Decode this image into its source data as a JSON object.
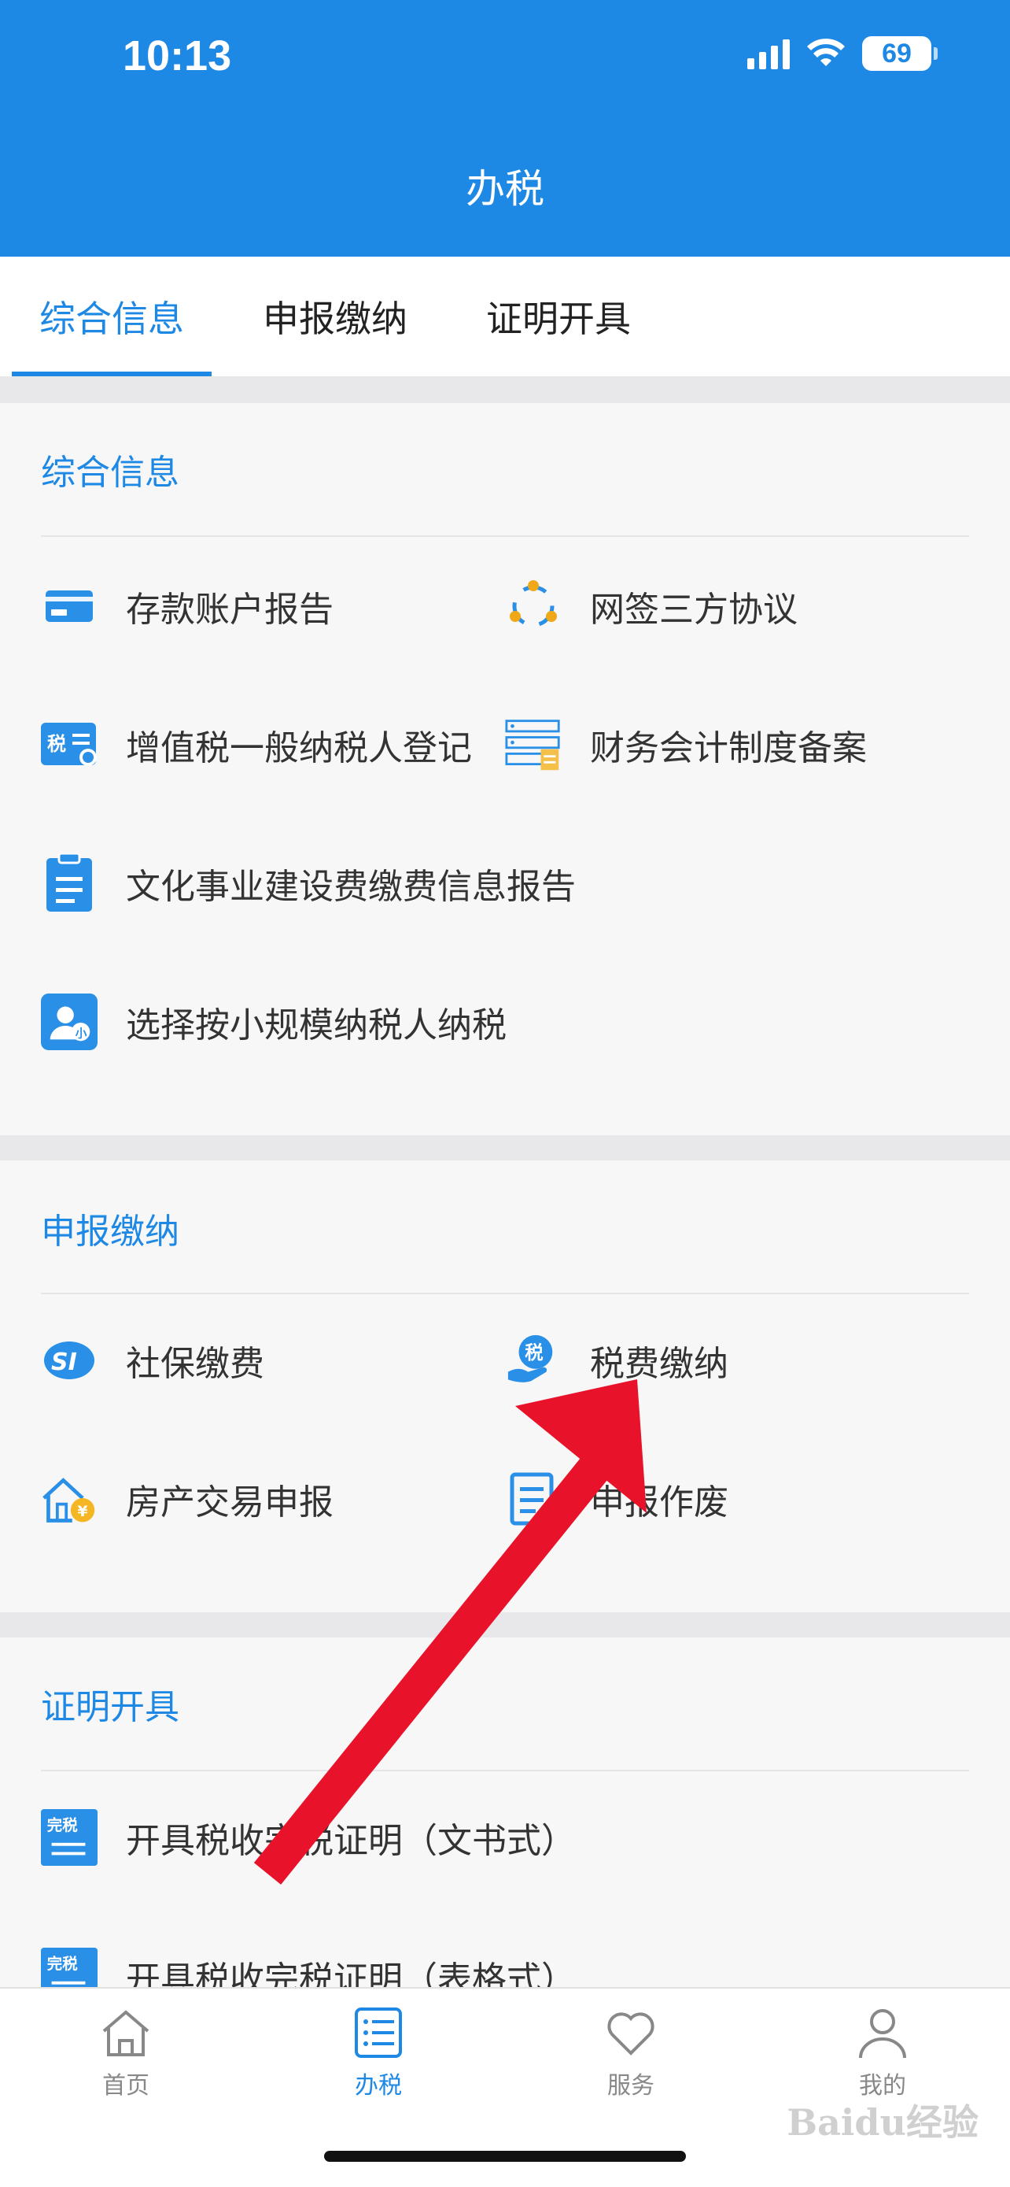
{
  "status_bar": {
    "time": "10:13",
    "battery": "69"
  },
  "header": {
    "title": "办税"
  },
  "tabs": [
    {
      "label": "综合信息",
      "active": true
    },
    {
      "label": "申报缴纳",
      "active": false
    },
    {
      "label": "证明开具",
      "active": false
    }
  ],
  "sections": {
    "info": {
      "title": "综合信息",
      "items": [
        {
          "label": "存款账户报告",
          "icon": "card-icon"
        },
        {
          "label": "网签三方协议",
          "icon": "network-icon"
        },
        {
          "label": "增值税一般纳税人登记",
          "icon": "tax-register-icon"
        },
        {
          "label": "财务会计制度备案",
          "icon": "server-doc-icon"
        },
        {
          "label": "文化事业建设费缴费信息报告",
          "icon": "clipboard-icon"
        },
        {
          "label": "选择按小规模纳税人纳税",
          "icon": "user-small-icon"
        }
      ]
    },
    "declare": {
      "title": "申报缴纳",
      "items": [
        {
          "label": "社保缴费",
          "icon": "social-insurance-icon"
        },
        {
          "label": "税费缴纳",
          "icon": "tax-pay-hand-icon"
        },
        {
          "label": "房产交易申报",
          "icon": "house-yen-icon"
        },
        {
          "label": "申报作废",
          "icon": "doc-void-icon"
        }
      ]
    },
    "cert": {
      "title": "证明开具",
      "items": [
        {
          "label": "开具税收完税证明（文书式）",
          "icon": "tax-cert-icon",
          "badge": "完税"
        },
        {
          "label": "开具税收完税证明（表格式）",
          "icon": "tax-cert-icon",
          "badge": "完税"
        }
      ]
    }
  },
  "bottom_nav": [
    {
      "label": "首页",
      "icon": "home-icon",
      "active": false
    },
    {
      "label": "办税",
      "icon": "list-icon",
      "active": true
    },
    {
      "label": "服务",
      "icon": "heart-icon",
      "active": false
    },
    {
      "label": "我的",
      "icon": "person-icon",
      "active": false
    }
  ],
  "watermark": "Baidu经验",
  "colors": {
    "primary": "#1e88e5",
    "arrow": "#e8132b"
  }
}
